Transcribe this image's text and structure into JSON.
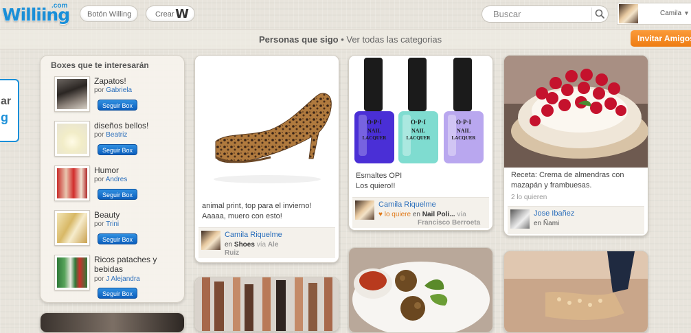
{
  "header": {
    "logo_text": "Williing",
    "logo_suffix": ".com",
    "boton_willing_label": "Botón Willing",
    "crear_label": "Crear",
    "search_placeholder": "Buscar",
    "user_name": "Camila",
    "icons": [
      "crear-w-icon",
      "search-icon",
      "chevron-down-icon"
    ]
  },
  "subnav": {
    "following_label": "Personas que sigo",
    "separator": " • ",
    "categories_label": "Ver todas las categorias",
    "invite_label": "Invitar Amigos"
  },
  "side_tab": {
    "line1": "ar",
    "line2": "g"
  },
  "boxes_panel": {
    "title": "Boxes que te interesarán",
    "items": [
      {
        "title": "Zapatos!",
        "by_label": "por",
        "user": "Gabriela",
        "button": "Seguir Box"
      },
      {
        "title": "diseños bellos!",
        "by_label": "por",
        "user": "Beatriz",
        "button": "Seguir Box"
      },
      {
        "title": "Humor",
        "by_label": "por",
        "user": "Andres",
        "button": "Seguir Box"
      },
      {
        "title": "Beauty",
        "by_label": "por",
        "user": "Trini",
        "button": "Seguir Box"
      },
      {
        "title": "Ricos pataches y bebidas",
        "by_label": "por",
        "user": "J Alejandra",
        "button": "Seguir Box"
      }
    ]
  },
  "cards": {
    "heel": {
      "caption_line1": "animal print, top para el invierno!",
      "caption_line2": "Aaaaa, muero con esto!",
      "user": "Camila Riquelme",
      "in_label": "en",
      "box": "Shoes",
      "via_label": "vía",
      "via_user_1": "Ale",
      "via_user_2": "Ruiz"
    },
    "opi": {
      "caption_line1": "Esmaltes OPI",
      "caption_line2": "Los quiero!!",
      "user": "Camila Riquelme",
      "heart_icon": "heart-icon",
      "loves_label": "lo quiere",
      "in_label": "en",
      "box": "Nail Poli...",
      "via_label": "vía",
      "via_user": "Francisco Berroeta",
      "bottle_brand": "O·P·I",
      "bottle_line1": "NAIL",
      "bottle_line2": "LACQUER"
    },
    "cake": {
      "caption_line1": "Receta: Crema de almendras con",
      "caption_line2": "mazapán y frambuesas.",
      "likes": "2 lo quieren",
      "user": "Jose Ibañez",
      "in_label": "en",
      "box": "Ñami"
    }
  },
  "colors": {
    "brand_blue": "#1a8fd8",
    "invite_orange": "#f28a22",
    "link_blue": "#2a6ebb"
  }
}
